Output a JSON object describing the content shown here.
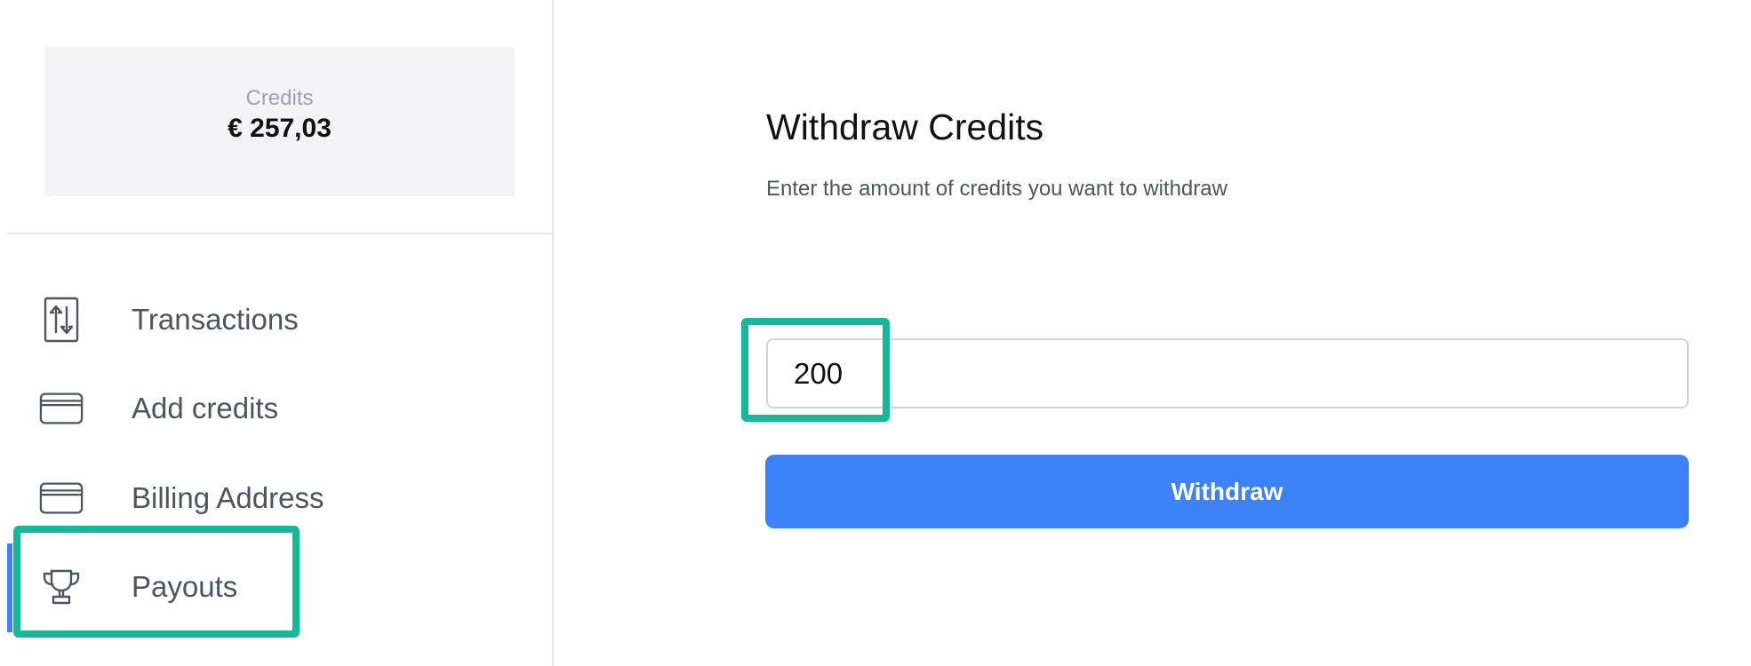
{
  "sidebar": {
    "credits": {
      "label": "Credits",
      "amount": "€ 257,03"
    },
    "items": [
      {
        "label": "Transactions",
        "icon": "transfer-arrows-icon"
      },
      {
        "label": "Add credits",
        "icon": "credit-card-icon"
      },
      {
        "label": "Billing Address",
        "icon": "credit-card-icon"
      },
      {
        "label": "Payouts",
        "icon": "trophy-icon",
        "active": true
      }
    ]
  },
  "main": {
    "title": "Withdraw Credits",
    "subtitle": "Enter the amount of credits you want to withdraw",
    "amount_input": {
      "value": "200"
    },
    "withdraw_label": "Withdraw"
  },
  "colors": {
    "accent": "#3b82f6",
    "highlight": "#14b89a",
    "card_background": "#f3f4f6",
    "text_muted": "#4b5563"
  }
}
